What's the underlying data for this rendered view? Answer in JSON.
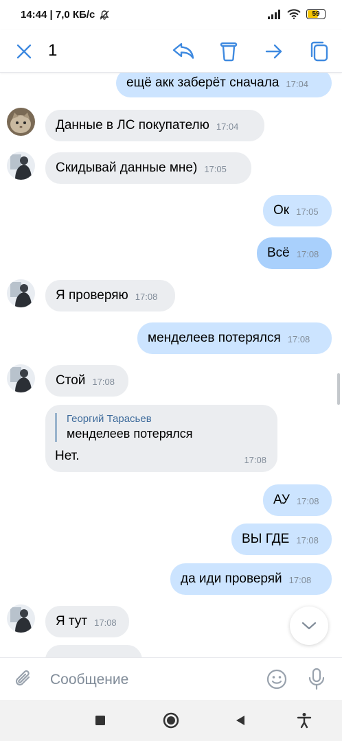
{
  "status_bar": {
    "time_info": "14:44 | 7,0 КБ/с",
    "battery": "59"
  },
  "header": {
    "selected_count": "1",
    "icons": [
      "close-icon",
      "reply-icon",
      "trash-icon",
      "forward-icon",
      "copy-icon"
    ]
  },
  "messages": [
    {
      "dir": "out",
      "text": "ещё акк заберёт сначала",
      "time": "17:04"
    },
    {
      "dir": "in",
      "avatar": "cat",
      "text": "Данные в ЛС покупателю",
      "time": "17:04"
    },
    {
      "dir": "in",
      "avatar": "person",
      "text": "Скидывай данные мне)",
      "time": "17:05"
    },
    {
      "dir": "out",
      "text": "Ок",
      "time": "17:05"
    },
    {
      "dir": "out",
      "text": "Всё",
      "time": "17:08",
      "selected": true
    },
    {
      "dir": "in",
      "avatar": "person",
      "text": "Я проверяю",
      "time": "17:08"
    },
    {
      "dir": "out",
      "text": "менделеев потерялся",
      "time": "17:08"
    },
    {
      "dir": "in",
      "avatar": "person",
      "text": "Стой",
      "time": "17:08"
    },
    {
      "dir": "in",
      "reply": {
        "author": "Георгий Тарасьев",
        "quote": "менделеев потерялся"
      },
      "text": "Нет.",
      "time": "17:08"
    },
    {
      "dir": "out",
      "text": "АУ",
      "time": "17:08"
    },
    {
      "dir": "out",
      "text": "ВЫ ГДЕ",
      "time": "17:08"
    },
    {
      "dir": "out",
      "text": "да иди проверяй",
      "time": "17:08"
    },
    {
      "dir": "in",
      "avatar": "person",
      "text": "Я тут",
      "time": "17:08"
    }
  ],
  "composer": {
    "placeholder": "Сообщение"
  }
}
